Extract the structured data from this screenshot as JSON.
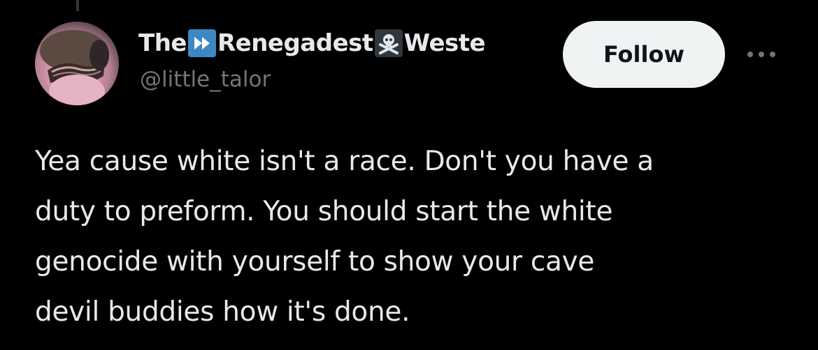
{
  "author": {
    "name_parts": [
      "The",
      "Renegadest",
      "Weste"
    ],
    "name_emojis": [
      "fast-forward-icon",
      "skull-crossbones-icon"
    ],
    "handle": "@little_talor",
    "avatar": "avatar-image"
  },
  "actions": {
    "follow_label": "Follow",
    "more_icon": "more-options-icon"
  },
  "post": {
    "lines": [
      "Yea cause white isn't a race. Don't you have a",
      "duty to preform. You should start the white",
      "genocide with yourself to show your cave",
      "devil buddies how it's done."
    ]
  },
  "colors": {
    "background": "#000000",
    "text_primary": "#e7e9ea",
    "text_secondary": "#71767b",
    "follow_bg": "#eff3f4",
    "emoji_blue": "#3b88c3"
  }
}
